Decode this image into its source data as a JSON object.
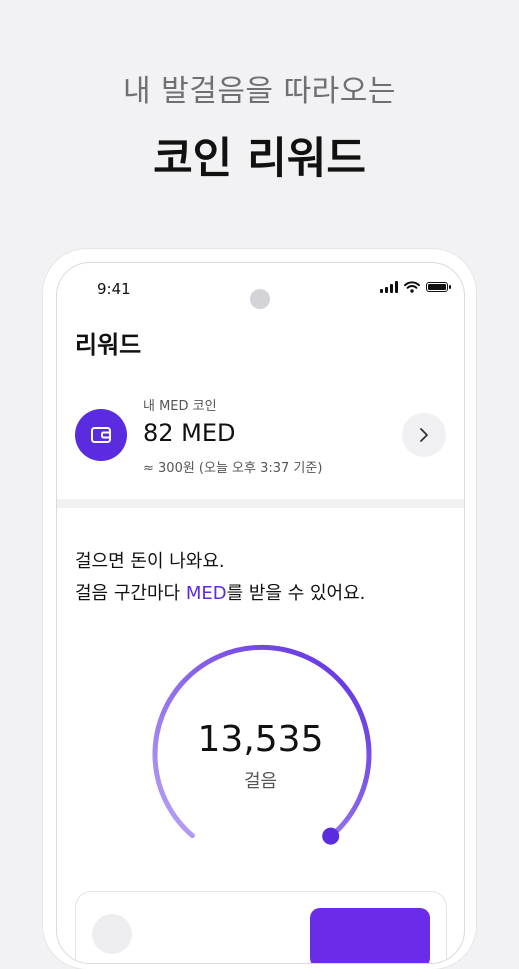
{
  "promo": {
    "subtitle": "내 발걸음을 따라오는",
    "title": "코인 리워드"
  },
  "status_bar": {
    "time": "9:41",
    "icons": [
      "signal-icon",
      "wifi-icon",
      "battery-icon"
    ]
  },
  "screen": {
    "title": "리워드"
  },
  "coin_card": {
    "caption": "내 MED 코인",
    "amount": "82 MED",
    "krw_estimate": "≈ 300원 (오늘 오후 3:37 기준)",
    "icon": "wallet-icon",
    "arrow_icon": "chevron-right-icon"
  },
  "description": {
    "line1": "걸으면 돈이 나와요.",
    "line2_prefix": "걸음 구간마다 ",
    "line2_highlight": "MED",
    "line2_suffix": "를 받을 수 있어요."
  },
  "steps": {
    "count": "13,535",
    "unit": "걸음"
  },
  "colors": {
    "accent": "#5b2be0",
    "gauge_start": "#b9a3f5",
    "gauge_end": "#5b2be0",
    "background": "#f2f2f4"
  }
}
